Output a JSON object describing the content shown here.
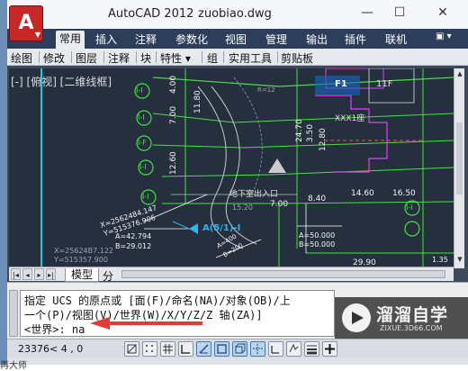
{
  "app": {
    "title": "AutoCAD 2012",
    "document": "zuobiao.dwg",
    "logo_letter": "A"
  },
  "window_controls": {
    "minimize": "—",
    "maximize": "☐",
    "close": "✕"
  },
  "ribbon_tabs": [
    "常用",
    "插入",
    "注释",
    "参数化",
    "视图",
    "管理",
    "输出",
    "插件",
    "联机"
  ],
  "ribbon_extra": "▣ ▾",
  "menubar": [
    "绘图",
    "修改",
    "图层",
    "注释",
    "块",
    "特性 ▾",
    "组",
    "实用工具",
    "剪贴板"
  ],
  "viewport": {
    "label": "[-] [俯视] [二维线框]"
  },
  "drawing": {
    "markers": [
      "I-I",
      "I-I",
      "I-F",
      "I-I",
      "I-I",
      "I-I"
    ],
    "dims_vertical": [
      "4.00",
      "7.00",
      "12.60",
      "24.70",
      "3.50",
      "12.80",
      "11.80"
    ],
    "dims_horizontal": [
      "8.40",
      "14.60",
      "7.00",
      "29.90",
      "16.50"
    ],
    "coord_left": [
      "X=2562484.147",
      "Y=515376.906",
      "A=42.794",
      "B=29.012"
    ],
    "coord_left_dim": [
      "X=25624B7.122",
      "Y=515357.900"
    ],
    "coord_right": [
      "A=50.000",
      "B=50.000"
    ],
    "point_label": "A(5/1)-I",
    "building_label": "XXX1座",
    "tag_f1": "F1",
    "tag_11f": "11F",
    "entrance": "地下室出入口",
    "stray": [
      "R=12",
      "15.20",
      "B=200",
      "A=400",
      "1.35"
    ]
  },
  "layout_tabs": {
    "nav": [
      "|◂",
      "◂",
      "▸",
      "▸|"
    ],
    "model": "模型",
    "layout": "分"
  },
  "command": {
    "line1": "指定 UCS 的原点或 [面(F)/命名(NA)/对象(OB)/上",
    "line2": "一个(P)/视图(V)/世界(W)/X/Y/Z/Z 轴(ZA)]",
    "line3": "<世界>: na"
  },
  "watermark": {
    "title": "溜溜自学",
    "url": "ZIXUE.3D66.COM"
  },
  "status": {
    "coords": "23376< 4    , 0"
  },
  "bottom_text": "再大师",
  "colors": {
    "titlebar": "#f4f6f9",
    "ribbon": "#2c3e5a",
    "canvas": "#262f3d",
    "arrow": "#e53935"
  }
}
